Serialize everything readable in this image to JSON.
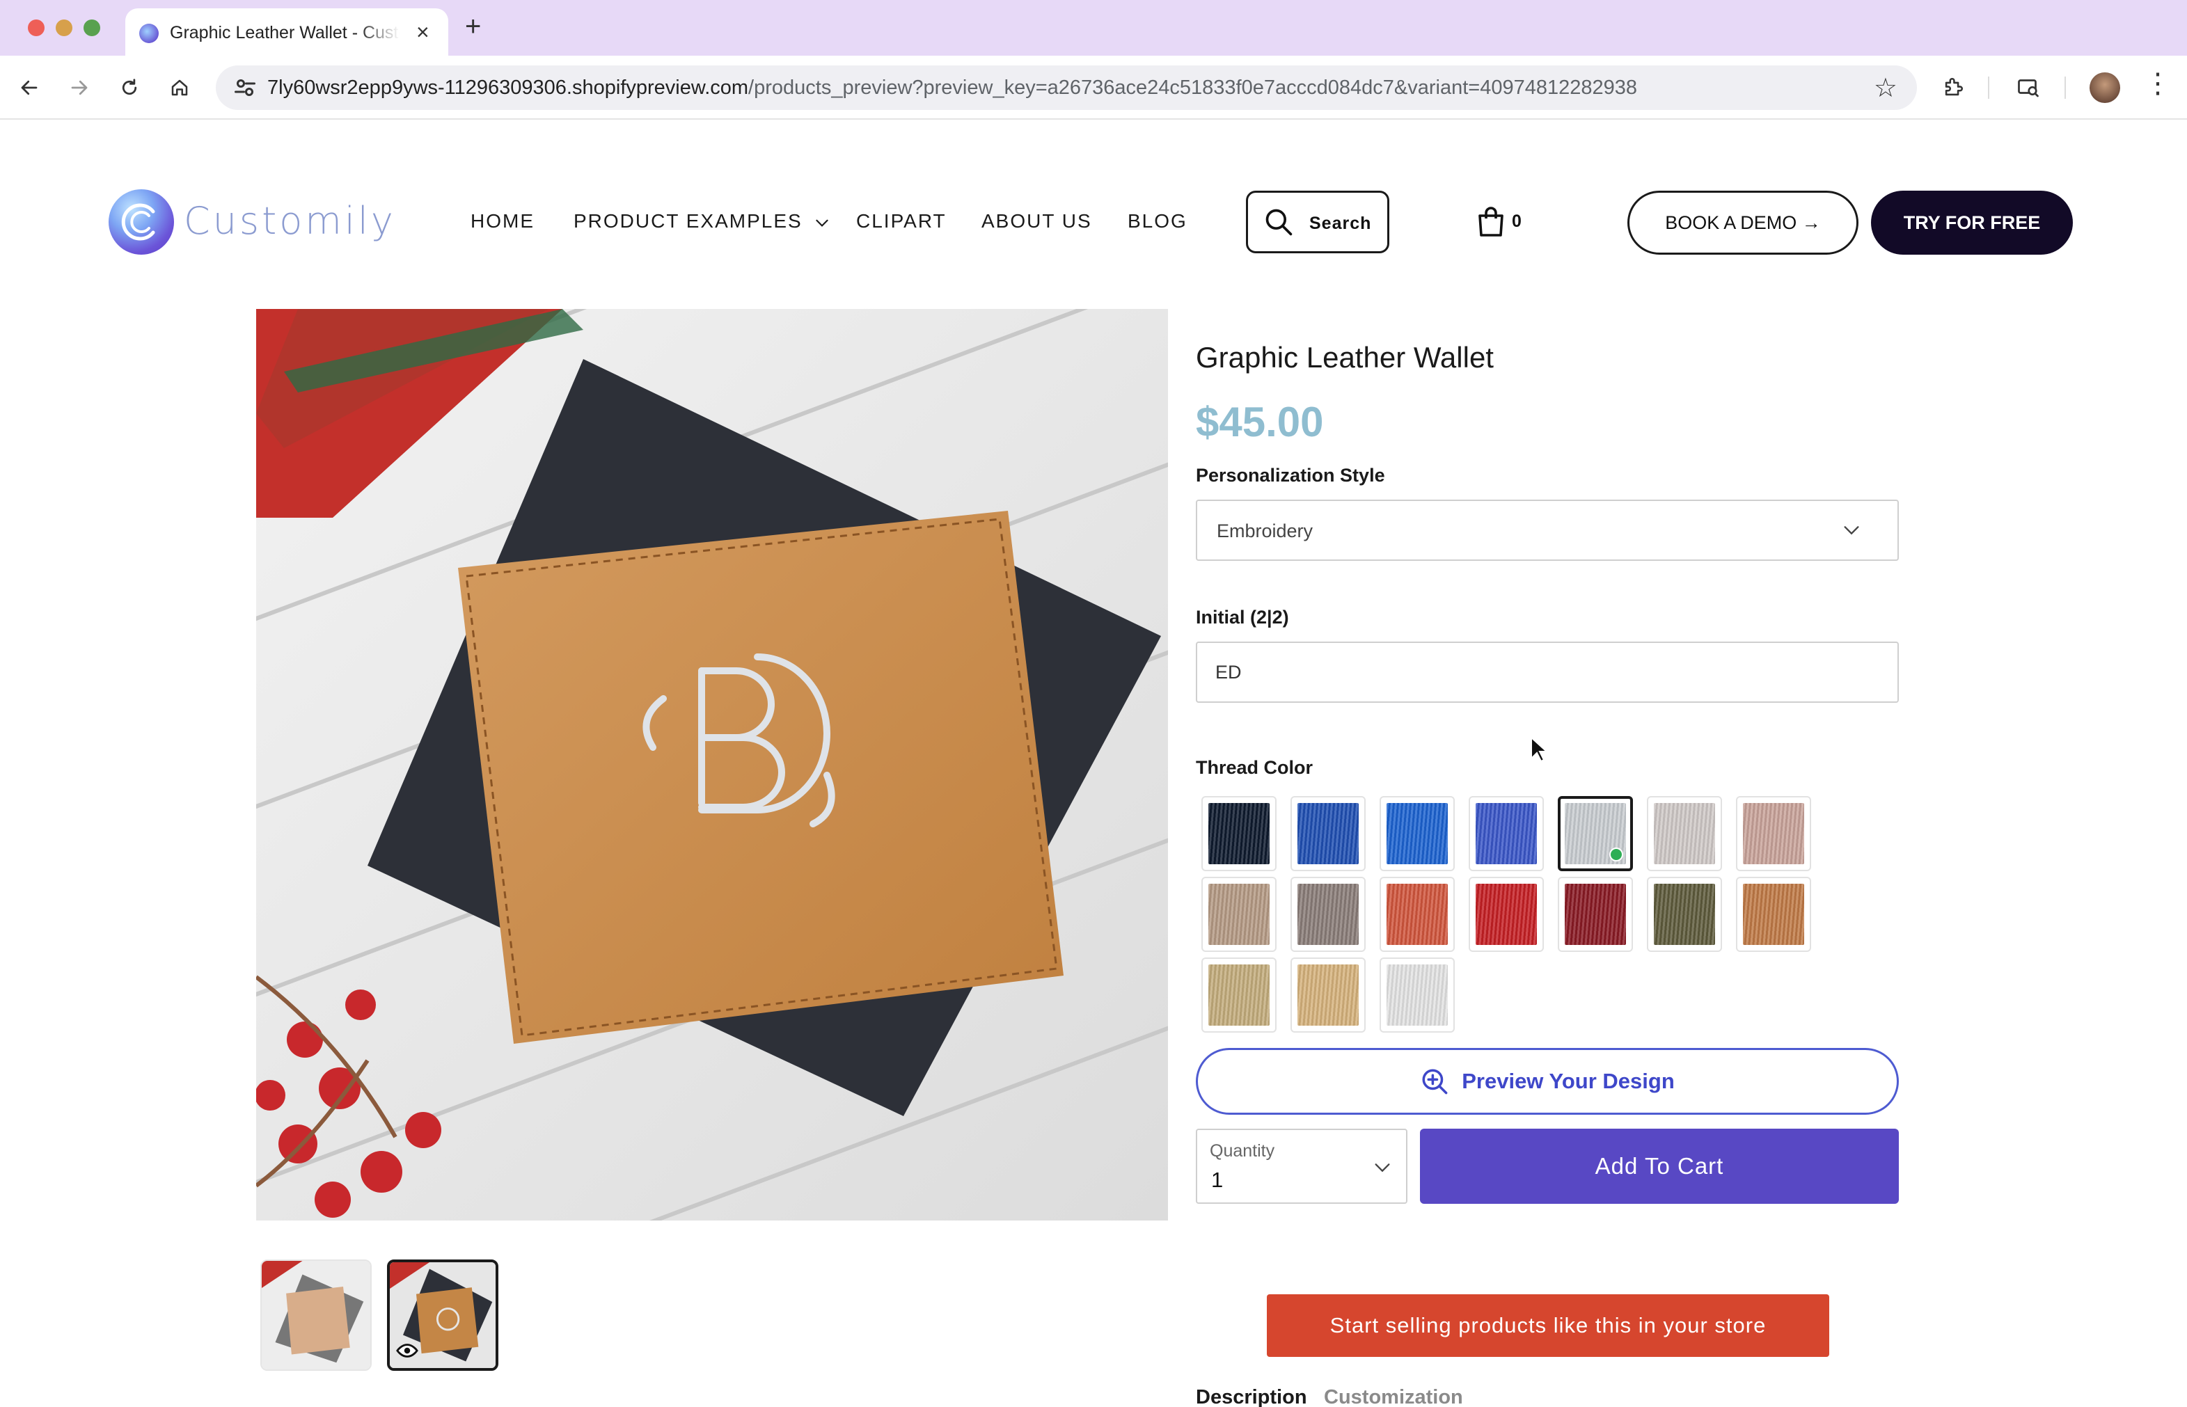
{
  "browser": {
    "tab_title": "Graphic Leather Wallet - Customily",
    "new_tab": "+",
    "url_host": "7ly60wsr2epp9yws-11296309306.shopifypreview.com",
    "url_path": "/products_preview?preview_key=a26736ace24c51833f0e7acccd084dc7&variant=40974812282938"
  },
  "site": {
    "logo_text": "Customily",
    "nav": {
      "home": "HOME",
      "product_examples": "PRODUCT EXAMPLES",
      "clipart": "CLIPART",
      "about_us": "ABOUT US",
      "blog": "BLOG"
    },
    "search_label": "Search",
    "cart_count": "0",
    "book_demo": "BOOK A DEMO →",
    "try_free": "TRY FOR FREE"
  },
  "product": {
    "title": "Graphic Leather Wallet",
    "price": "$45.00",
    "personalization_label": "Personalization Style",
    "personalization_value": "Embroidery",
    "initial_label": "Initial (2|2)",
    "initial_value": "ED",
    "thread_color_label": "Thread Color",
    "selected_thread_index": 4,
    "preview_button": "Preview Your Design",
    "quantity_label": "Quantity",
    "quantity_value": "1",
    "add_to_cart": "Add To Cart",
    "sell_banner": "Start selling products like this in your store",
    "tabs": [
      "Description",
      "Customization"
    ]
  },
  "thread_colors": [
    "#0e1a2e",
    "#1f4fb3",
    "#1c63d1",
    "#3a57c9",
    "#c9cdd1",
    "#cfc9c7",
    "#c9a39a",
    "#b59a84",
    "#8a7d78",
    "#d1563d",
    "#c61f24",
    "#8a1a24",
    "#5e5b3c",
    "#c07a46",
    "#c3ac7c",
    "#d6b27c",
    "#e3e3e3"
  ]
}
